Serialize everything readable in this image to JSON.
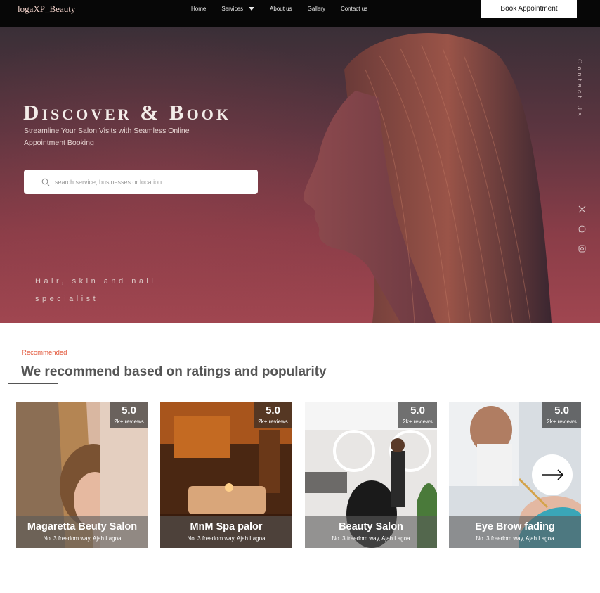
{
  "nav": {
    "logo": "logaXP_Beauty",
    "links": [
      "Home",
      "Services",
      "About us",
      "Gallery",
      "Contact us"
    ],
    "cta": "Book Appointment"
  },
  "hero": {
    "title": "Discover & Book",
    "subtitle": "Streamline Your Salon Visits with Seamless Online Appointment Booking",
    "search_placeholder": "search service, businesses or location",
    "specialist_line1": "Hair, skin and nail",
    "specialist_line2": "specialist",
    "contact": "Contact Us",
    "social_icons": [
      "x-icon",
      "whatsapp-icon",
      "instagram-icon"
    ]
  },
  "recommended": {
    "label": "Recommended",
    "title": "We recommend based on ratings and popularity",
    "cards": [
      {
        "name": "Magaretta Beuty Salon",
        "address": "No. 3 freedom way, Ajah Lagoa",
        "rating": "5.0",
        "reviews": "2k+ reviews"
      },
      {
        "name": "MnM Spa palor",
        "address": "No. 3 freedom way, Ajah Lagoa",
        "rating": "5.0",
        "reviews": "2k+ reviews"
      },
      {
        "name": "Beauty Salon",
        "address": "No. 3 freedom way, Ajah Lagoa",
        "rating": "5.0",
        "reviews": "2k+ reviews"
      },
      {
        "name": "Eye Brow fading",
        "address": "No. 3 freedom way, Ajah Lagoa",
        "rating": "5.0",
        "reviews": "2k+ reviews"
      }
    ],
    "next_icon": "arrow-right-icon"
  },
  "colors": {
    "nav_bg": "#070707",
    "accent": "#e35a3e",
    "hero_bg": "#8a3d48"
  }
}
